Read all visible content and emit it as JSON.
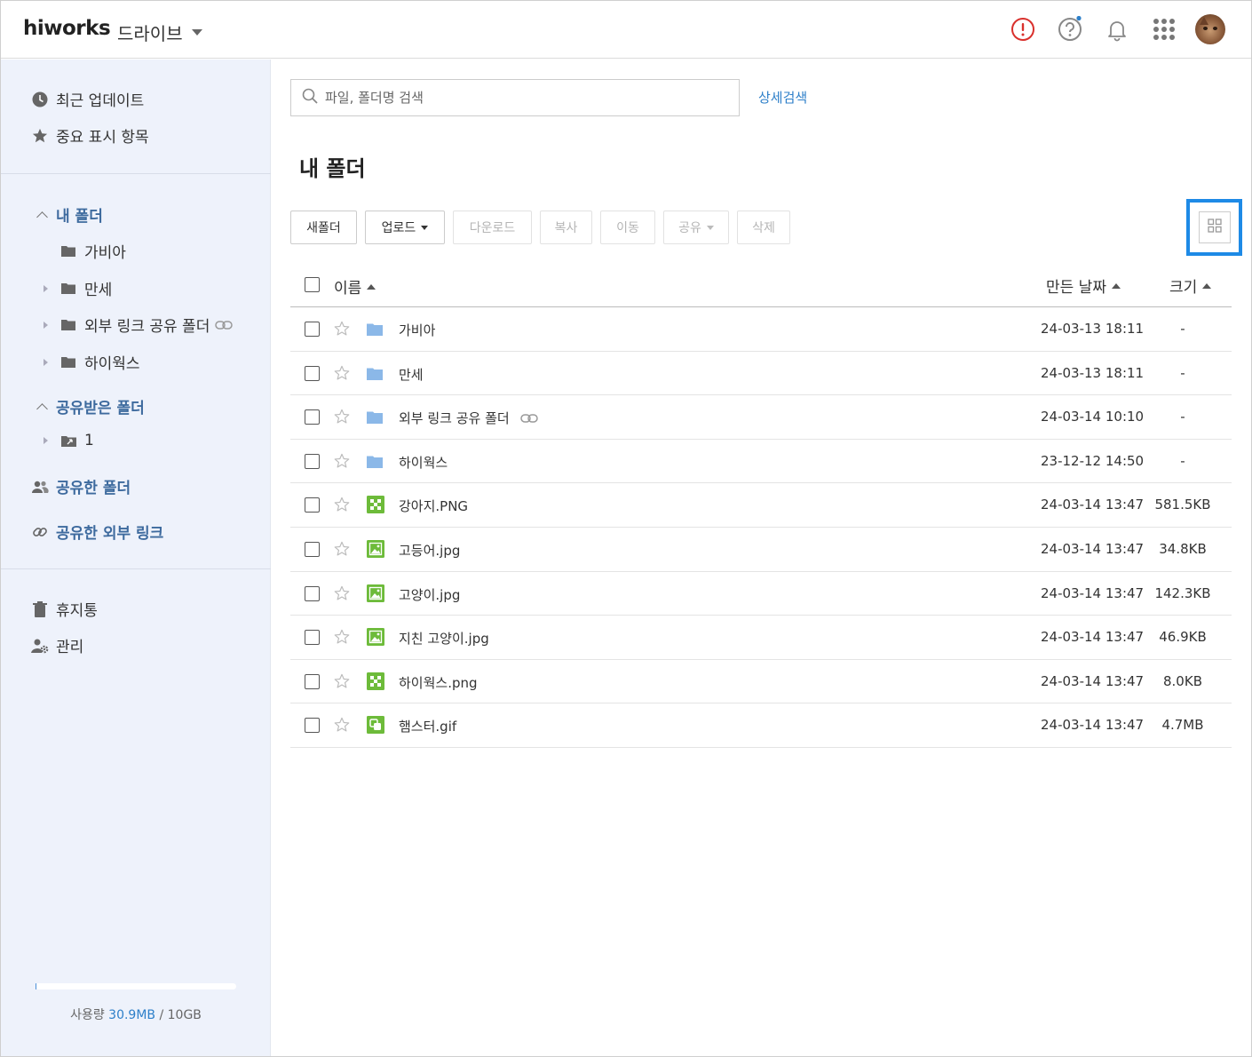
{
  "header": {
    "logo": "hiworks",
    "app_name": "드라이브"
  },
  "sidebar": {
    "recent_label": "최근 업데이트",
    "starred_label": "중요 표시 항목",
    "my_folder": {
      "label": "내 폴더",
      "items": [
        {
          "label": "가비아",
          "expandable": false
        },
        {
          "label": "만세",
          "expandable": true
        },
        {
          "label": "외부 링크 공유 폴더",
          "expandable": true,
          "link": true
        },
        {
          "label": "하이웍스",
          "expandable": true
        }
      ]
    },
    "shared_in": {
      "label": "공유받은 폴더",
      "items": [
        {
          "label": "1",
          "expandable": true
        }
      ]
    },
    "shared_out_label": "공유한 폴더",
    "shared_links_label": "공유한 외부 링크",
    "trash_label": "휴지통",
    "admin_label": "관리",
    "usage": {
      "label": "사용량",
      "used": "30.9MB",
      "separator": "/",
      "total": "10GB",
      "fraction": 0.003
    }
  },
  "search": {
    "placeholder": "파일, 폴더명 검색",
    "advanced_label": "상세검색"
  },
  "page_title": "내 폴더",
  "toolbar": {
    "new_folder": "새폴더",
    "upload": "업로드",
    "download": "다운로드",
    "copy": "복사",
    "move": "이동",
    "share": "공유",
    "delete": "삭제"
  },
  "table": {
    "col_name": "이름",
    "col_date": "만든 날짜",
    "col_size": "크기",
    "rows": [
      {
        "name": "가비아",
        "type": "folder",
        "date": "24-03-13 18:11",
        "size": "-"
      },
      {
        "name": "만세",
        "type": "folder",
        "date": "24-03-13 18:11",
        "size": "-"
      },
      {
        "name": "외부 링크 공유 폴더",
        "type": "folder",
        "link": true,
        "date": "24-03-14 10:10",
        "size": "-"
      },
      {
        "name": "하이웍스",
        "type": "folder",
        "date": "23-12-12 14:50",
        "size": "-"
      },
      {
        "name": "강아지.PNG",
        "type": "png",
        "date": "24-03-14 13:47",
        "size": "581.5KB"
      },
      {
        "name": "고등어.jpg",
        "type": "jpg",
        "date": "24-03-14 13:47",
        "size": "34.8KB"
      },
      {
        "name": "고양이.jpg",
        "type": "jpg",
        "date": "24-03-14 13:47",
        "size": "142.3KB"
      },
      {
        "name": "지친 고양이.jpg",
        "type": "jpg",
        "date": "24-03-14 13:47",
        "size": "46.9KB"
      },
      {
        "name": "하이웍스.png",
        "type": "png",
        "date": "24-03-14 13:47",
        "size": "8.0KB"
      },
      {
        "name": "햄스터.gif",
        "type": "gif",
        "date": "24-03-14 13:47",
        "size": "4.7MB"
      }
    ]
  },
  "colors": {
    "accent": "#2d7fc9",
    "highlight": "#1e8ae6",
    "sidebar_bg": "#eef2fb",
    "folder": "#8bb8e8",
    "image": "#6dbb3a",
    "alert": "#d9302c"
  },
  "icons": {
    "alert": "alert-circle-icon",
    "help": "help-circle-icon",
    "notifications": "bell-icon",
    "apps": "apps-grid-icon",
    "view": "grid-view-icon"
  }
}
